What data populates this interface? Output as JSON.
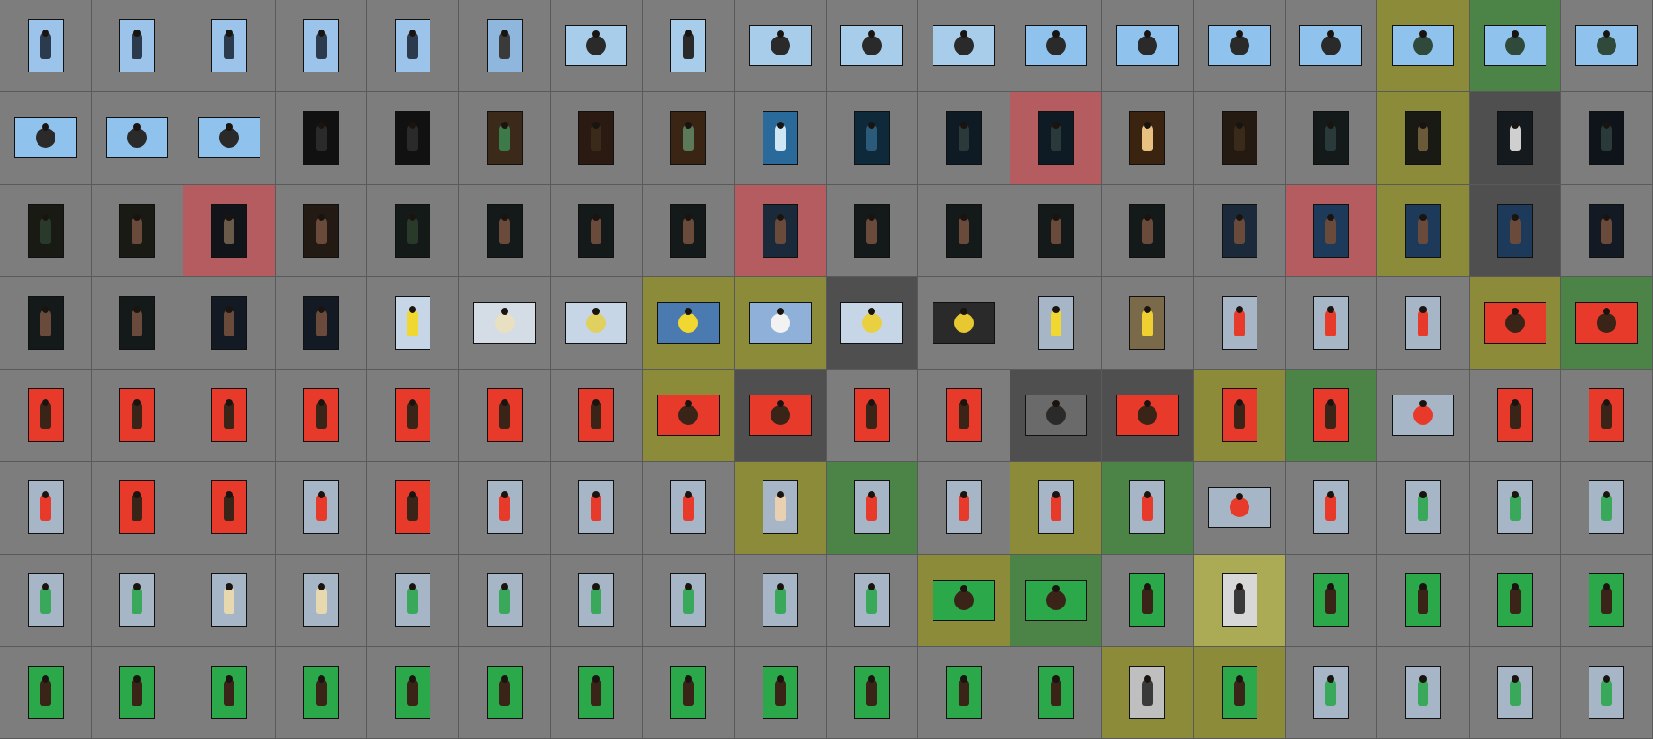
{
  "grid": {
    "columns": 18,
    "rows": 8,
    "cells": [
      {
        "label": "none",
        "orient": "p",
        "bg": "#9cc4ea",
        "fg": "#2b3a4c"
      },
      {
        "label": "none",
        "orient": "p",
        "bg": "#9cc4ea",
        "fg": "#2b3a4c"
      },
      {
        "label": "none",
        "orient": "p",
        "bg": "#9cc4ea",
        "fg": "#2b3a4c"
      },
      {
        "label": "none",
        "orient": "p",
        "bg": "#9cc4ea",
        "fg": "#2b3a4c"
      },
      {
        "label": "none",
        "orient": "p",
        "bg": "#9cc4ea",
        "fg": "#2b3a4c"
      },
      {
        "label": "none",
        "orient": "p",
        "bg": "#8fb6dc",
        "fg": "#3a3a3a"
      },
      {
        "label": "none",
        "orient": "l",
        "bg": "#a8cdea",
        "fg": "#2a2a2a"
      },
      {
        "label": "none",
        "orient": "p",
        "bg": "#a8cdea",
        "fg": "#2a2a2a"
      },
      {
        "label": "none",
        "orient": "l",
        "bg": "#a8cdea",
        "fg": "#2a2a2a"
      },
      {
        "label": "none",
        "orient": "l",
        "bg": "#a8cdea",
        "fg": "#2a2a2a"
      },
      {
        "label": "none",
        "orient": "l",
        "bg": "#a8cdea",
        "fg": "#2a2a2a"
      },
      {
        "label": "none",
        "orient": "l",
        "bg": "#8fc3ee",
        "fg": "#2a2a2a"
      },
      {
        "label": "none",
        "orient": "l",
        "bg": "#8fc3ee",
        "fg": "#2a2a2a"
      },
      {
        "label": "none",
        "orient": "l",
        "bg": "#8fc3ee",
        "fg": "#2a2a2a"
      },
      {
        "label": "none",
        "orient": "l",
        "bg": "#8fc3ee",
        "fg": "#2a2a2a"
      },
      {
        "label": "yellow",
        "orient": "l",
        "bg": "#8fc3ee",
        "fg": "#2f4a3a"
      },
      {
        "label": "green",
        "orient": "l",
        "bg": "#8fc3ee",
        "fg": "#2f4a3a"
      },
      {
        "label": "none",
        "orient": "l",
        "bg": "#8fc3ee",
        "fg": "#2f4a3a"
      },
      {
        "label": "none",
        "orient": "l",
        "bg": "#8fc3ee",
        "fg": "#2a2a2a"
      },
      {
        "label": "none",
        "orient": "l",
        "bg": "#8fc3ee",
        "fg": "#2a2a2a"
      },
      {
        "label": "none",
        "orient": "l",
        "bg": "#8fc3ee",
        "fg": "#2a2a2a"
      },
      {
        "label": "none",
        "orient": "p",
        "bg": "#111111",
        "fg": "#2a2a2a"
      },
      {
        "label": "none",
        "orient": "p",
        "bg": "#111111",
        "fg": "#2a2a2a"
      },
      {
        "label": "none",
        "orient": "p",
        "bg": "#3b2a1a",
        "fg": "#3c7a4a"
      },
      {
        "label": "none",
        "orient": "p",
        "bg": "#2a1a12",
        "fg": "#3a2a1a"
      },
      {
        "label": "none",
        "orient": "p",
        "bg": "#3a2414",
        "fg": "#5a7a5a"
      },
      {
        "label": "none",
        "orient": "p",
        "bg": "#2a6a9a",
        "fg": "#cfe6f5"
      },
      {
        "label": "none",
        "orient": "p",
        "bg": "#0e2a3a",
        "fg": "#2c5a7a"
      },
      {
        "label": "none",
        "orient": "p",
        "bg": "#0e1a24",
        "fg": "#2a3a3a"
      },
      {
        "label": "red",
        "orient": "p",
        "bg": "#0e1a24",
        "fg": "#2a3a3a"
      },
      {
        "label": "none",
        "orient": "p",
        "bg": "#3a2410",
        "fg": "#e8c080"
      },
      {
        "label": "none",
        "orient": "p",
        "bg": "#241a12",
        "fg": "#3a2a1a"
      },
      {
        "label": "none",
        "orient": "p",
        "bg": "#141a1a",
        "fg": "#2a3a3a"
      },
      {
        "label": "yellow",
        "orient": "p",
        "bg": "#1a1a14",
        "fg": "#6a5a3a"
      },
      {
        "label": "selected",
        "orient": "p",
        "bg": "#141a1e",
        "fg": "#cfcfcf"
      },
      {
        "label": "none",
        "orient": "p",
        "bg": "#0e141a",
        "fg": "#2a3a3a"
      },
      {
        "label": "none",
        "orient": "p",
        "bg": "#1a1a14",
        "fg": "#2a3a2a"
      },
      {
        "label": "none",
        "orient": "p",
        "bg": "#1a1a14",
        "fg": "#6a4a3a"
      },
      {
        "label": "red",
        "orient": "p",
        "bg": "#111418",
        "fg": "#6a5a4a"
      },
      {
        "label": "none",
        "orient": "p",
        "bg": "#241a14",
        "fg": "#6a4a3a"
      },
      {
        "label": "none",
        "orient": "p",
        "bg": "#141a18",
        "fg": "#2a3a2a"
      },
      {
        "label": "none",
        "orient": "p",
        "bg": "#141a1a",
        "fg": "#6a4a3a"
      },
      {
        "label": "none",
        "orient": "p",
        "bg": "#141a1a",
        "fg": "#6a4a3a"
      },
      {
        "label": "none",
        "orient": "p",
        "bg": "#141a1a",
        "fg": "#6a4a3a"
      },
      {
        "label": "red",
        "orient": "p",
        "bg": "#1a2a3a",
        "fg": "#6a4a3a"
      },
      {
        "label": "none",
        "orient": "p",
        "bg": "#141a1a",
        "fg": "#6a4a3a"
      },
      {
        "label": "none",
        "orient": "p",
        "bg": "#141a1a",
        "fg": "#6a4a3a"
      },
      {
        "label": "none",
        "orient": "p",
        "bg": "#141a1a",
        "fg": "#6a4a3a"
      },
      {
        "label": "none",
        "orient": "p",
        "bg": "#141a1a",
        "fg": "#6a4a3a"
      },
      {
        "label": "none",
        "orient": "p",
        "bg": "#1a2a3a",
        "fg": "#6a4a3a"
      },
      {
        "label": "red",
        "orient": "p",
        "bg": "#1e3a5a",
        "fg": "#6a4a3a"
      },
      {
        "label": "yellow",
        "orient": "p",
        "bg": "#1e3a5a",
        "fg": "#6a4a3a"
      },
      {
        "label": "selected",
        "orient": "p",
        "bg": "#1e3a5a",
        "fg": "#6a4a3a"
      },
      {
        "label": "none",
        "orient": "p",
        "bg": "#141a24",
        "fg": "#6a4a3a"
      },
      {
        "label": "none",
        "orient": "p",
        "bg": "#141a1a",
        "fg": "#6a4a3a"
      },
      {
        "label": "none",
        "orient": "p",
        "bg": "#141a1a",
        "fg": "#6a4a3a"
      },
      {
        "label": "none",
        "orient": "p",
        "bg": "#141a24",
        "fg": "#6a4a3a"
      },
      {
        "label": "none",
        "orient": "p",
        "bg": "#141a24",
        "fg": "#6a4a3a"
      },
      {
        "label": "none",
        "orient": "p",
        "bg": "#c7d6e6",
        "fg": "#f0d830"
      },
      {
        "label": "none",
        "orient": "l",
        "bg": "#d4dde6",
        "fg": "#e8e0c0"
      },
      {
        "label": "none",
        "orient": "l",
        "bg": "#c7d6e6",
        "fg": "#e0d060"
      },
      {
        "label": "yellow",
        "orient": "l",
        "bg": "#4a7ab0",
        "fg": "#f0d830"
      },
      {
        "label": "yellow",
        "orient": "l",
        "bg": "#8fb0d8",
        "fg": "#f2f2f2"
      },
      {
        "label": "selected",
        "orient": "l",
        "bg": "#c7d6e6",
        "fg": "#e8d040"
      },
      {
        "label": "none",
        "orient": "l",
        "bg": "#2a2a2a",
        "fg": "#e8c830"
      },
      {
        "label": "none",
        "orient": "p",
        "bg": "#a7b6c6",
        "fg": "#f0d830"
      },
      {
        "label": "none",
        "orient": "p",
        "bg": "#7a6a4a",
        "fg": "#f0d030"
      },
      {
        "label": "none",
        "orient": "p",
        "bg": "#a7b6c6",
        "fg": "#e83a2a"
      },
      {
        "label": "none",
        "orient": "p",
        "bg": "#a7b6c6",
        "fg": "#e83a2a"
      },
      {
        "label": "none",
        "orient": "p",
        "bg": "#a7b6c6",
        "fg": "#e83a2a"
      },
      {
        "label": "yellow",
        "orient": "l",
        "bg": "#e83a2a",
        "fg": "#3a2418"
      },
      {
        "label": "green",
        "orient": "l",
        "bg": "#e83a2a",
        "fg": "#3a2418"
      },
      {
        "label": "none",
        "orient": "p",
        "bg": "#e83a2a",
        "fg": "#3a2418"
      },
      {
        "label": "none",
        "orient": "p",
        "bg": "#e83a2a",
        "fg": "#3a2418"
      },
      {
        "label": "none",
        "orient": "p",
        "bg": "#e83a2a",
        "fg": "#3a2418"
      },
      {
        "label": "none",
        "orient": "p",
        "bg": "#e83a2a",
        "fg": "#3a2418"
      },
      {
        "label": "none",
        "orient": "p",
        "bg": "#e83a2a",
        "fg": "#3a2418"
      },
      {
        "label": "none",
        "orient": "p",
        "bg": "#e83a2a",
        "fg": "#3a2418"
      },
      {
        "label": "none",
        "orient": "p",
        "bg": "#e83a2a",
        "fg": "#3a2418"
      },
      {
        "label": "yellow",
        "orient": "l",
        "bg": "#e83a2a",
        "fg": "#3a2418"
      },
      {
        "label": "selected",
        "orient": "l",
        "bg": "#e83a2a",
        "fg": "#3a2418"
      },
      {
        "label": "none",
        "orient": "p",
        "bg": "#e83a2a",
        "fg": "#3a2418"
      },
      {
        "label": "none",
        "orient": "p",
        "bg": "#e83a2a",
        "fg": "#3a2418"
      },
      {
        "label": "selected",
        "orient": "l",
        "bg": "#6a6a6a",
        "fg": "#2a2a2a"
      },
      {
        "label": "selected",
        "orient": "l",
        "bg": "#e83a2a",
        "fg": "#3a2418"
      },
      {
        "label": "yellow",
        "orient": "p",
        "bg": "#e83a2a",
        "fg": "#3a2418"
      },
      {
        "label": "green",
        "orient": "p",
        "bg": "#e83a2a",
        "fg": "#3a2418"
      },
      {
        "label": "none",
        "orient": "l",
        "bg": "#a7b6c6",
        "fg": "#e83a2a"
      },
      {
        "label": "none",
        "orient": "p",
        "bg": "#e83a2a",
        "fg": "#3a2418"
      },
      {
        "label": "none",
        "orient": "p",
        "bg": "#e83a2a",
        "fg": "#3a2418"
      },
      {
        "label": "none",
        "orient": "p",
        "bg": "#a7b6c6",
        "fg": "#e83a2a"
      },
      {
        "label": "none",
        "orient": "p",
        "bg": "#e83a2a",
        "fg": "#3a2418"
      },
      {
        "label": "none",
        "orient": "p",
        "bg": "#e83a2a",
        "fg": "#3a2418"
      },
      {
        "label": "none",
        "orient": "p",
        "bg": "#a7b6c6",
        "fg": "#e83a2a"
      },
      {
        "label": "none",
        "orient": "p",
        "bg": "#e83a2a",
        "fg": "#3a2418"
      },
      {
        "label": "none",
        "orient": "p",
        "bg": "#a7b6c6",
        "fg": "#e83a2a"
      },
      {
        "label": "none",
        "orient": "p",
        "bg": "#a7b6c6",
        "fg": "#e83a2a"
      },
      {
        "label": "none",
        "orient": "p",
        "bg": "#a7b6c6",
        "fg": "#e83a2a"
      },
      {
        "label": "yellow",
        "orient": "p",
        "bg": "#a7b6c6",
        "fg": "#e8d0b0"
      },
      {
        "label": "green",
        "orient": "p",
        "bg": "#a7b6c6",
        "fg": "#e83a2a"
      },
      {
        "label": "none",
        "orient": "p",
        "bg": "#a7b6c6",
        "fg": "#e83a2a"
      },
      {
        "label": "yellow",
        "orient": "p",
        "bg": "#a7b6c6",
        "fg": "#e83a2a"
      },
      {
        "label": "green",
        "orient": "p",
        "bg": "#a7b6c6",
        "fg": "#e83a2a"
      },
      {
        "label": "none",
        "orient": "l",
        "bg": "#a7b6c6",
        "fg": "#e83a2a"
      },
      {
        "label": "none",
        "orient": "p",
        "bg": "#a7b6c6",
        "fg": "#e83a2a"
      },
      {
        "label": "none",
        "orient": "p",
        "bg": "#a7b6c6",
        "fg": "#3aa85a"
      },
      {
        "label": "none",
        "orient": "p",
        "bg": "#a7b6c6",
        "fg": "#3aa85a"
      },
      {
        "label": "none",
        "orient": "p",
        "bg": "#a7b6c6",
        "fg": "#3aa85a"
      },
      {
        "label": "none",
        "orient": "p",
        "bg": "#a7b6c6",
        "fg": "#3aa85a"
      },
      {
        "label": "none",
        "orient": "p",
        "bg": "#a7b6c6",
        "fg": "#3aa85a"
      },
      {
        "label": "none",
        "orient": "p",
        "bg": "#a7b6c6",
        "fg": "#e8d8b0"
      },
      {
        "label": "none",
        "orient": "p",
        "bg": "#a7b6c6",
        "fg": "#e8d8b0"
      },
      {
        "label": "none",
        "orient": "p",
        "bg": "#a7b6c6",
        "fg": "#3aa85a"
      },
      {
        "label": "none",
        "orient": "p",
        "bg": "#a7b6c6",
        "fg": "#3aa85a"
      },
      {
        "label": "none",
        "orient": "p",
        "bg": "#a7b6c6",
        "fg": "#3aa85a"
      },
      {
        "label": "none",
        "orient": "p",
        "bg": "#a7b6c6",
        "fg": "#3aa85a"
      },
      {
        "label": "none",
        "orient": "p",
        "bg": "#a7b6c6",
        "fg": "#3aa85a"
      },
      {
        "label": "none",
        "orient": "p",
        "bg": "#a7b6c6",
        "fg": "#3aa85a"
      },
      {
        "label": "yellow",
        "orient": "l",
        "bg": "#2aa84a",
        "fg": "#3a2418"
      },
      {
        "label": "green",
        "orient": "l",
        "bg": "#2aa84a",
        "fg": "#3a2418"
      },
      {
        "label": "none",
        "orient": "p",
        "bg": "#2aa84a",
        "fg": "#3a2418"
      },
      {
        "label": "lightyellow",
        "orient": "p",
        "bg": "#d8d8d8",
        "fg": "#3a3a3a"
      },
      {
        "label": "none",
        "orient": "p",
        "bg": "#2aa84a",
        "fg": "#3a2418"
      },
      {
        "label": "none",
        "orient": "p",
        "bg": "#2aa84a",
        "fg": "#3a2418"
      },
      {
        "label": "none",
        "orient": "p",
        "bg": "#2aa84a",
        "fg": "#3a2418"
      },
      {
        "label": "none",
        "orient": "p",
        "bg": "#2aa84a",
        "fg": "#3a2418"
      },
      {
        "label": "none",
        "orient": "p",
        "bg": "#2aa84a",
        "fg": "#3a2418"
      },
      {
        "label": "none",
        "orient": "p",
        "bg": "#2aa84a",
        "fg": "#3a2418"
      },
      {
        "label": "none",
        "orient": "p",
        "bg": "#2aa84a",
        "fg": "#3a2418"
      },
      {
        "label": "none",
        "orient": "p",
        "bg": "#2aa84a",
        "fg": "#3a2418"
      },
      {
        "label": "none",
        "orient": "p",
        "bg": "#2aa84a",
        "fg": "#3a2418"
      },
      {
        "label": "none",
        "orient": "p",
        "bg": "#2aa84a",
        "fg": "#3a2418"
      },
      {
        "label": "none",
        "orient": "p",
        "bg": "#2aa84a",
        "fg": "#3a2418"
      },
      {
        "label": "none",
        "orient": "p",
        "bg": "#2aa84a",
        "fg": "#3a2418"
      },
      {
        "label": "none",
        "orient": "p",
        "bg": "#2aa84a",
        "fg": "#3a2418"
      },
      {
        "label": "none",
        "orient": "p",
        "bg": "#2aa84a",
        "fg": "#3a2418"
      },
      {
        "label": "none",
        "orient": "p",
        "bg": "#2aa84a",
        "fg": "#3a2418"
      },
      {
        "label": "none",
        "orient": "p",
        "bg": "#2aa84a",
        "fg": "#3a2418"
      },
      {
        "label": "yellow",
        "orient": "p",
        "bg": "#bfbfbf",
        "fg": "#3a3a3a"
      },
      {
        "label": "yellow",
        "orient": "p",
        "bg": "#2aa84a",
        "fg": "#3a2418"
      },
      {
        "label": "none",
        "orient": "p",
        "bg": "#a7b6c6",
        "fg": "#3aa85a"
      },
      {
        "label": "none",
        "orient": "p",
        "bg": "#a7b6c6",
        "fg": "#3aa85a"
      },
      {
        "label": "none",
        "orient": "p",
        "bg": "#a7b6c6",
        "fg": "#3aa85a"
      },
      {
        "label": "none",
        "orient": "p",
        "bg": "#a7b6c6",
        "fg": "#3aa85a"
      }
    ]
  }
}
